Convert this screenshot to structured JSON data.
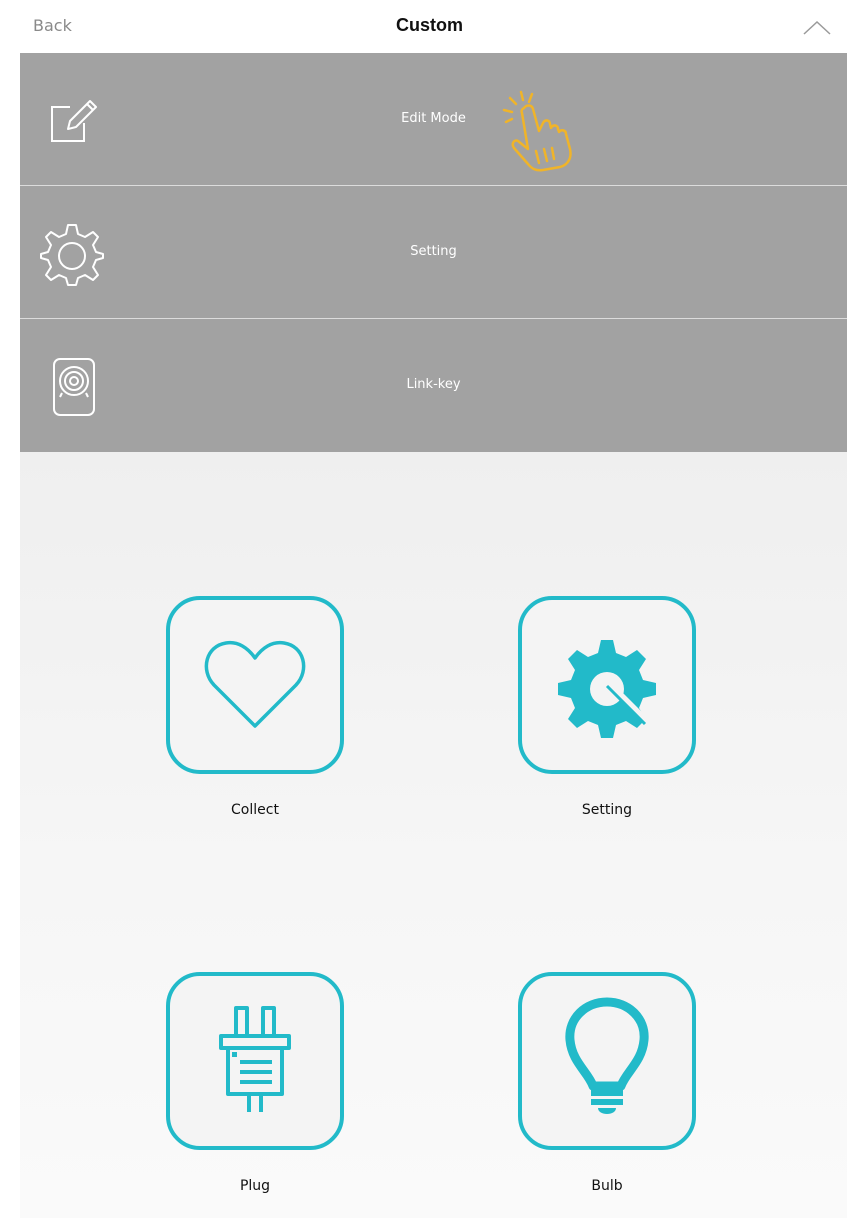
{
  "header": {
    "back_label": "Back",
    "title": "Custom",
    "collapse_icon": "chevron-up-icon"
  },
  "menu": {
    "items": [
      {
        "label": "Edit Mode",
        "icon": "edit-icon"
      },
      {
        "label": "Setting",
        "icon": "gear-icon"
      },
      {
        "label": "Link-key",
        "icon": "link-key-icon"
      }
    ],
    "pointer_icon": "tap-hand-icon",
    "pointer_color": "#f0b429"
  },
  "tiles": [
    {
      "label": "Collect",
      "icon": "heart-icon"
    },
    {
      "label": "Setting",
      "icon": "wrench-gear-icon"
    },
    {
      "label": "Plug",
      "icon": "plug-icon"
    },
    {
      "label": "Bulb",
      "icon": "bulb-icon"
    }
  ],
  "colors": {
    "accent": "#22bac9",
    "menu_background": "#a2a2a2",
    "menu_text": "#ffffff"
  }
}
